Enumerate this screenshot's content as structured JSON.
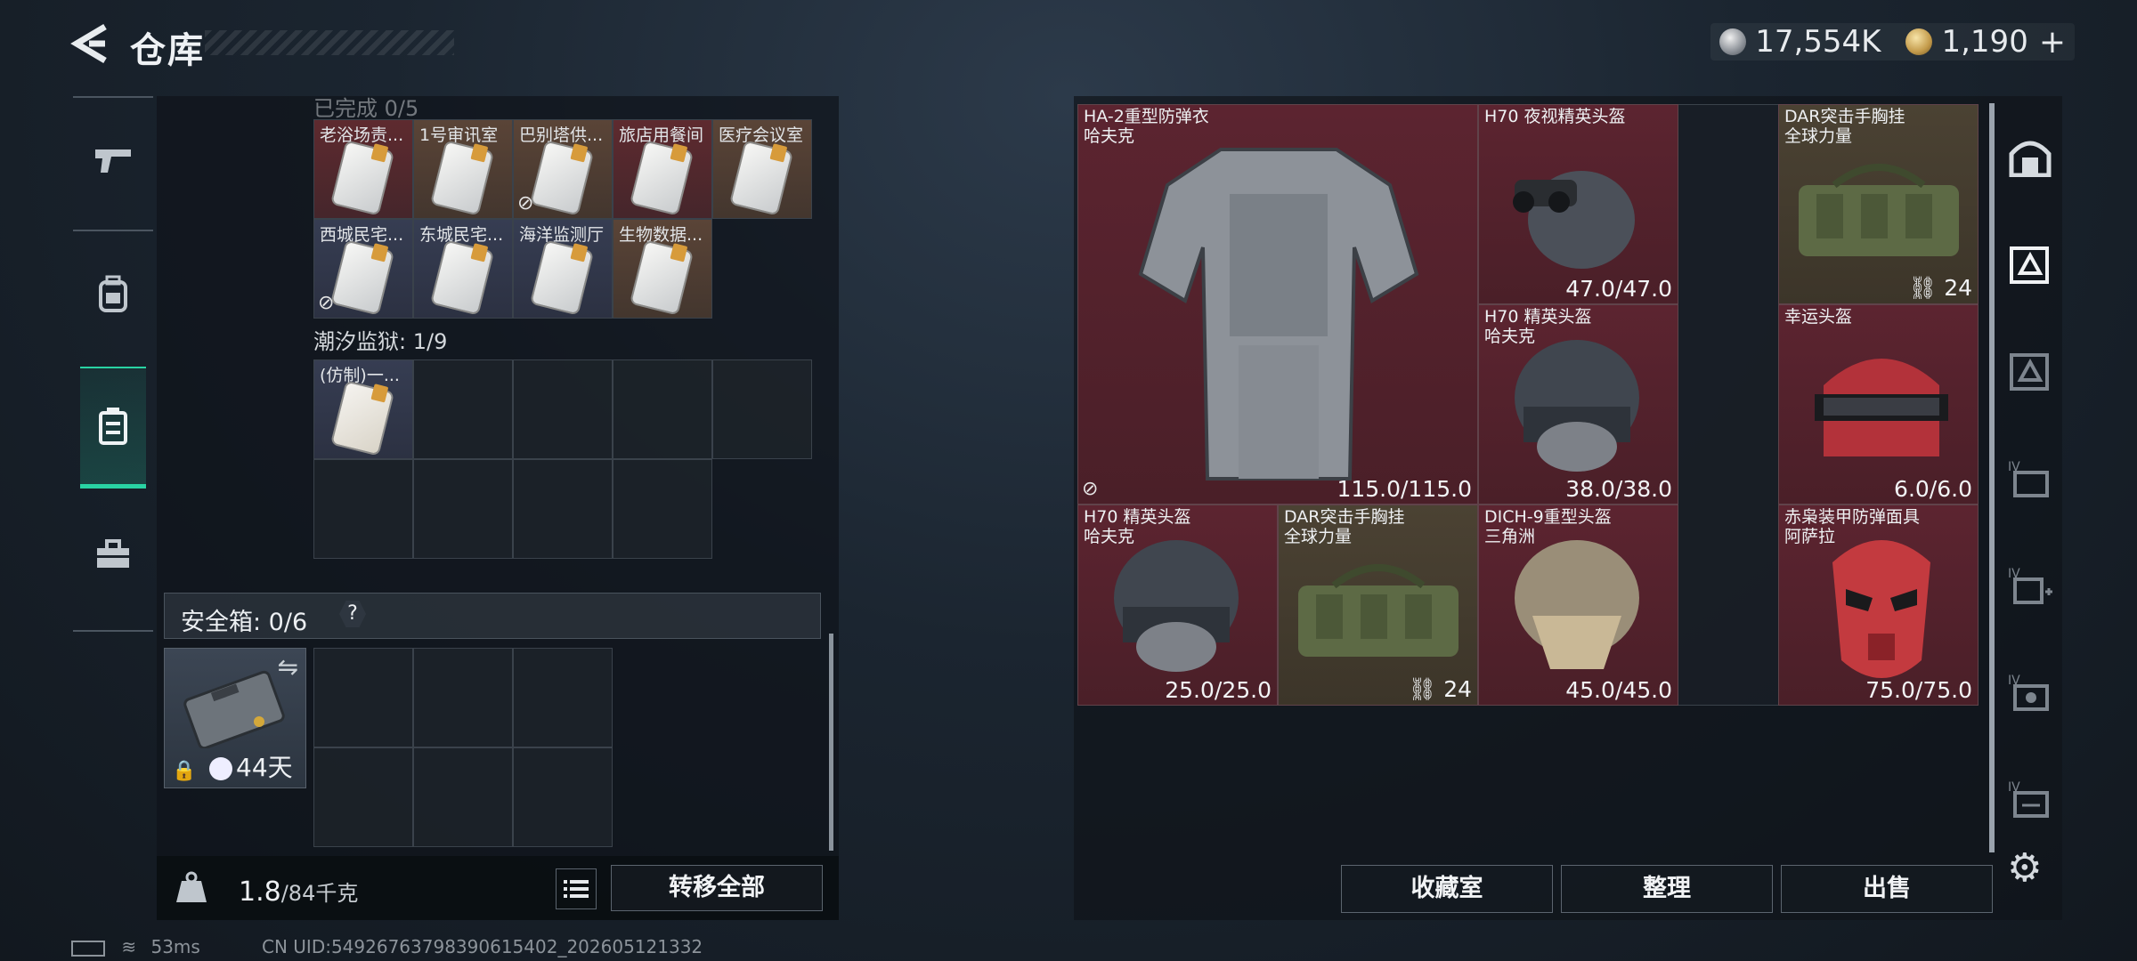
{
  "header": {
    "title": "仓库",
    "currency": [
      {
        "icon": "silver-coin-icon",
        "value": "17,554K"
      },
      {
        "icon": "gold-coin-icon",
        "value": "1,190"
      }
    ],
    "plus_label": "+"
  },
  "left_nav": {
    "items": [
      {
        "icon": "pistol-icon",
        "active": false
      },
      {
        "icon": "backpack-icon",
        "active": false
      },
      {
        "icon": "container-icon",
        "active": true
      },
      {
        "icon": "toolbox-icon",
        "active": false
      }
    ]
  },
  "keys_section": {
    "partial_heading": "已完成 0/5",
    "rows": [
      [
        {
          "label": "老浴场责...",
          "color": "red"
        },
        {
          "label": "1号审讯室",
          "color": "tan"
        },
        {
          "label": "巴别塔供...",
          "color": "tan",
          "no_link": true
        },
        {
          "label": "旅店用餐间",
          "color": "red"
        },
        {
          "label": "医疗会议室",
          "color": "tan"
        }
      ],
      [
        {
          "label": "西城民宅...",
          "color": "blue",
          "no_link": true
        },
        {
          "label": "东城民宅...",
          "color": "blue"
        },
        {
          "label": "海洋监测厅",
          "color": "blue"
        },
        {
          "label": "生物数据...",
          "color": "tan"
        }
      ]
    ]
  },
  "prison_section": {
    "heading": "潮汐监狱: 1/9",
    "items": [
      {
        "label": "(仿制)一..."
      }
    ]
  },
  "safe_box": {
    "label": "安全箱: 0/6",
    "help": "?",
    "days": "44天"
  },
  "bottom_left": {
    "weight_current": "1.8",
    "weight_max": "/84千克",
    "transfer_all": "转移全部"
  },
  "stash_items": [
    {
      "name": "HA-2重型防弹衣",
      "sub": "哈夫克",
      "durability": "115.0/115.0",
      "color": "red",
      "kind": "vest",
      "no_link": true
    },
    {
      "name": "H70 夜视精英头盔",
      "sub": "",
      "durability": "47.0/47.0",
      "color": "red",
      "kind": "helmet-nv"
    },
    {
      "name": "DAR突击手胸挂",
      "sub": "全球力量",
      "count": "24",
      "color": "olive",
      "kind": "rig"
    },
    {
      "name": "H70 精英头盔",
      "sub": "哈夫克",
      "durability": "38.0/38.0",
      "color": "red",
      "kind": "helmet"
    },
    {
      "name": "幸运头盔",
      "sub": "",
      "durability": "6.0/6.0",
      "color": "red",
      "kind": "helmet-red"
    },
    {
      "name": "H70 精英头盔",
      "sub": "哈夫克",
      "durability": "25.0/25.0",
      "color": "red",
      "kind": "helmet"
    },
    {
      "name": "DAR突击手胸挂",
      "sub": "全球力量",
      "count": "24",
      "color": "olive",
      "kind": "rig"
    },
    {
      "name": "DICH-9重型头盔",
      "sub": "三角洲",
      "durability": "45.0/45.0",
      "color": "red",
      "kind": "helmet-tan"
    },
    {
      "name": "赤枭装甲防弹面具",
      "sub": "阿萨拉",
      "durability": "75.0/75.0",
      "color": "red",
      "kind": "mask"
    }
  ],
  "right_rail": {
    "items": [
      "vault-icon",
      "supply-box-icon",
      "supply-box-alt-icon",
      "tier4-folder-icon",
      "tier4-add-icon",
      "tier4-camera-icon",
      "tier4-ticket-icon"
    ]
  },
  "actions": {
    "collection": "收藏室",
    "organize": "整理",
    "sell": "出售"
  },
  "status": {
    "ping": "53ms",
    "uid": "CN UID:54926763798390615402_202605121332"
  },
  "colors": {
    "accent": "#29d3a3",
    "item_red": "#5c2430",
    "item_olive": "#4b4233"
  }
}
